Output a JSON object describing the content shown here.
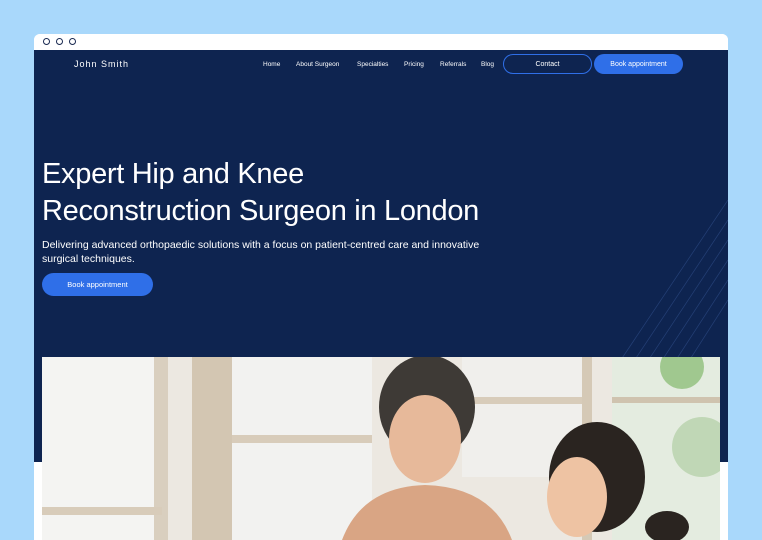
{
  "brand": {
    "name": "John Smith"
  },
  "nav": {
    "items": [
      {
        "label": "Home"
      },
      {
        "label": "About Surgeon"
      },
      {
        "label": "Specialties"
      },
      {
        "label": "Pricing"
      },
      {
        "label": "Referrals"
      },
      {
        "label": "Blog"
      }
    ],
    "contact_label": "Contact",
    "book_label": "Book appointment"
  },
  "hero": {
    "title_line1": "Expert Hip and Knee",
    "title_line2": "Reconstruction Surgeon in London",
    "subtitle": "Delivering advanced orthopaedic solutions with a focus on patient-centred care and innovative surgical techniques.",
    "cta_label": "Book appointment"
  },
  "colors": {
    "page_bg": "#a9d8fb",
    "navy": "#0e2450",
    "accent": "#2f6fe8"
  }
}
